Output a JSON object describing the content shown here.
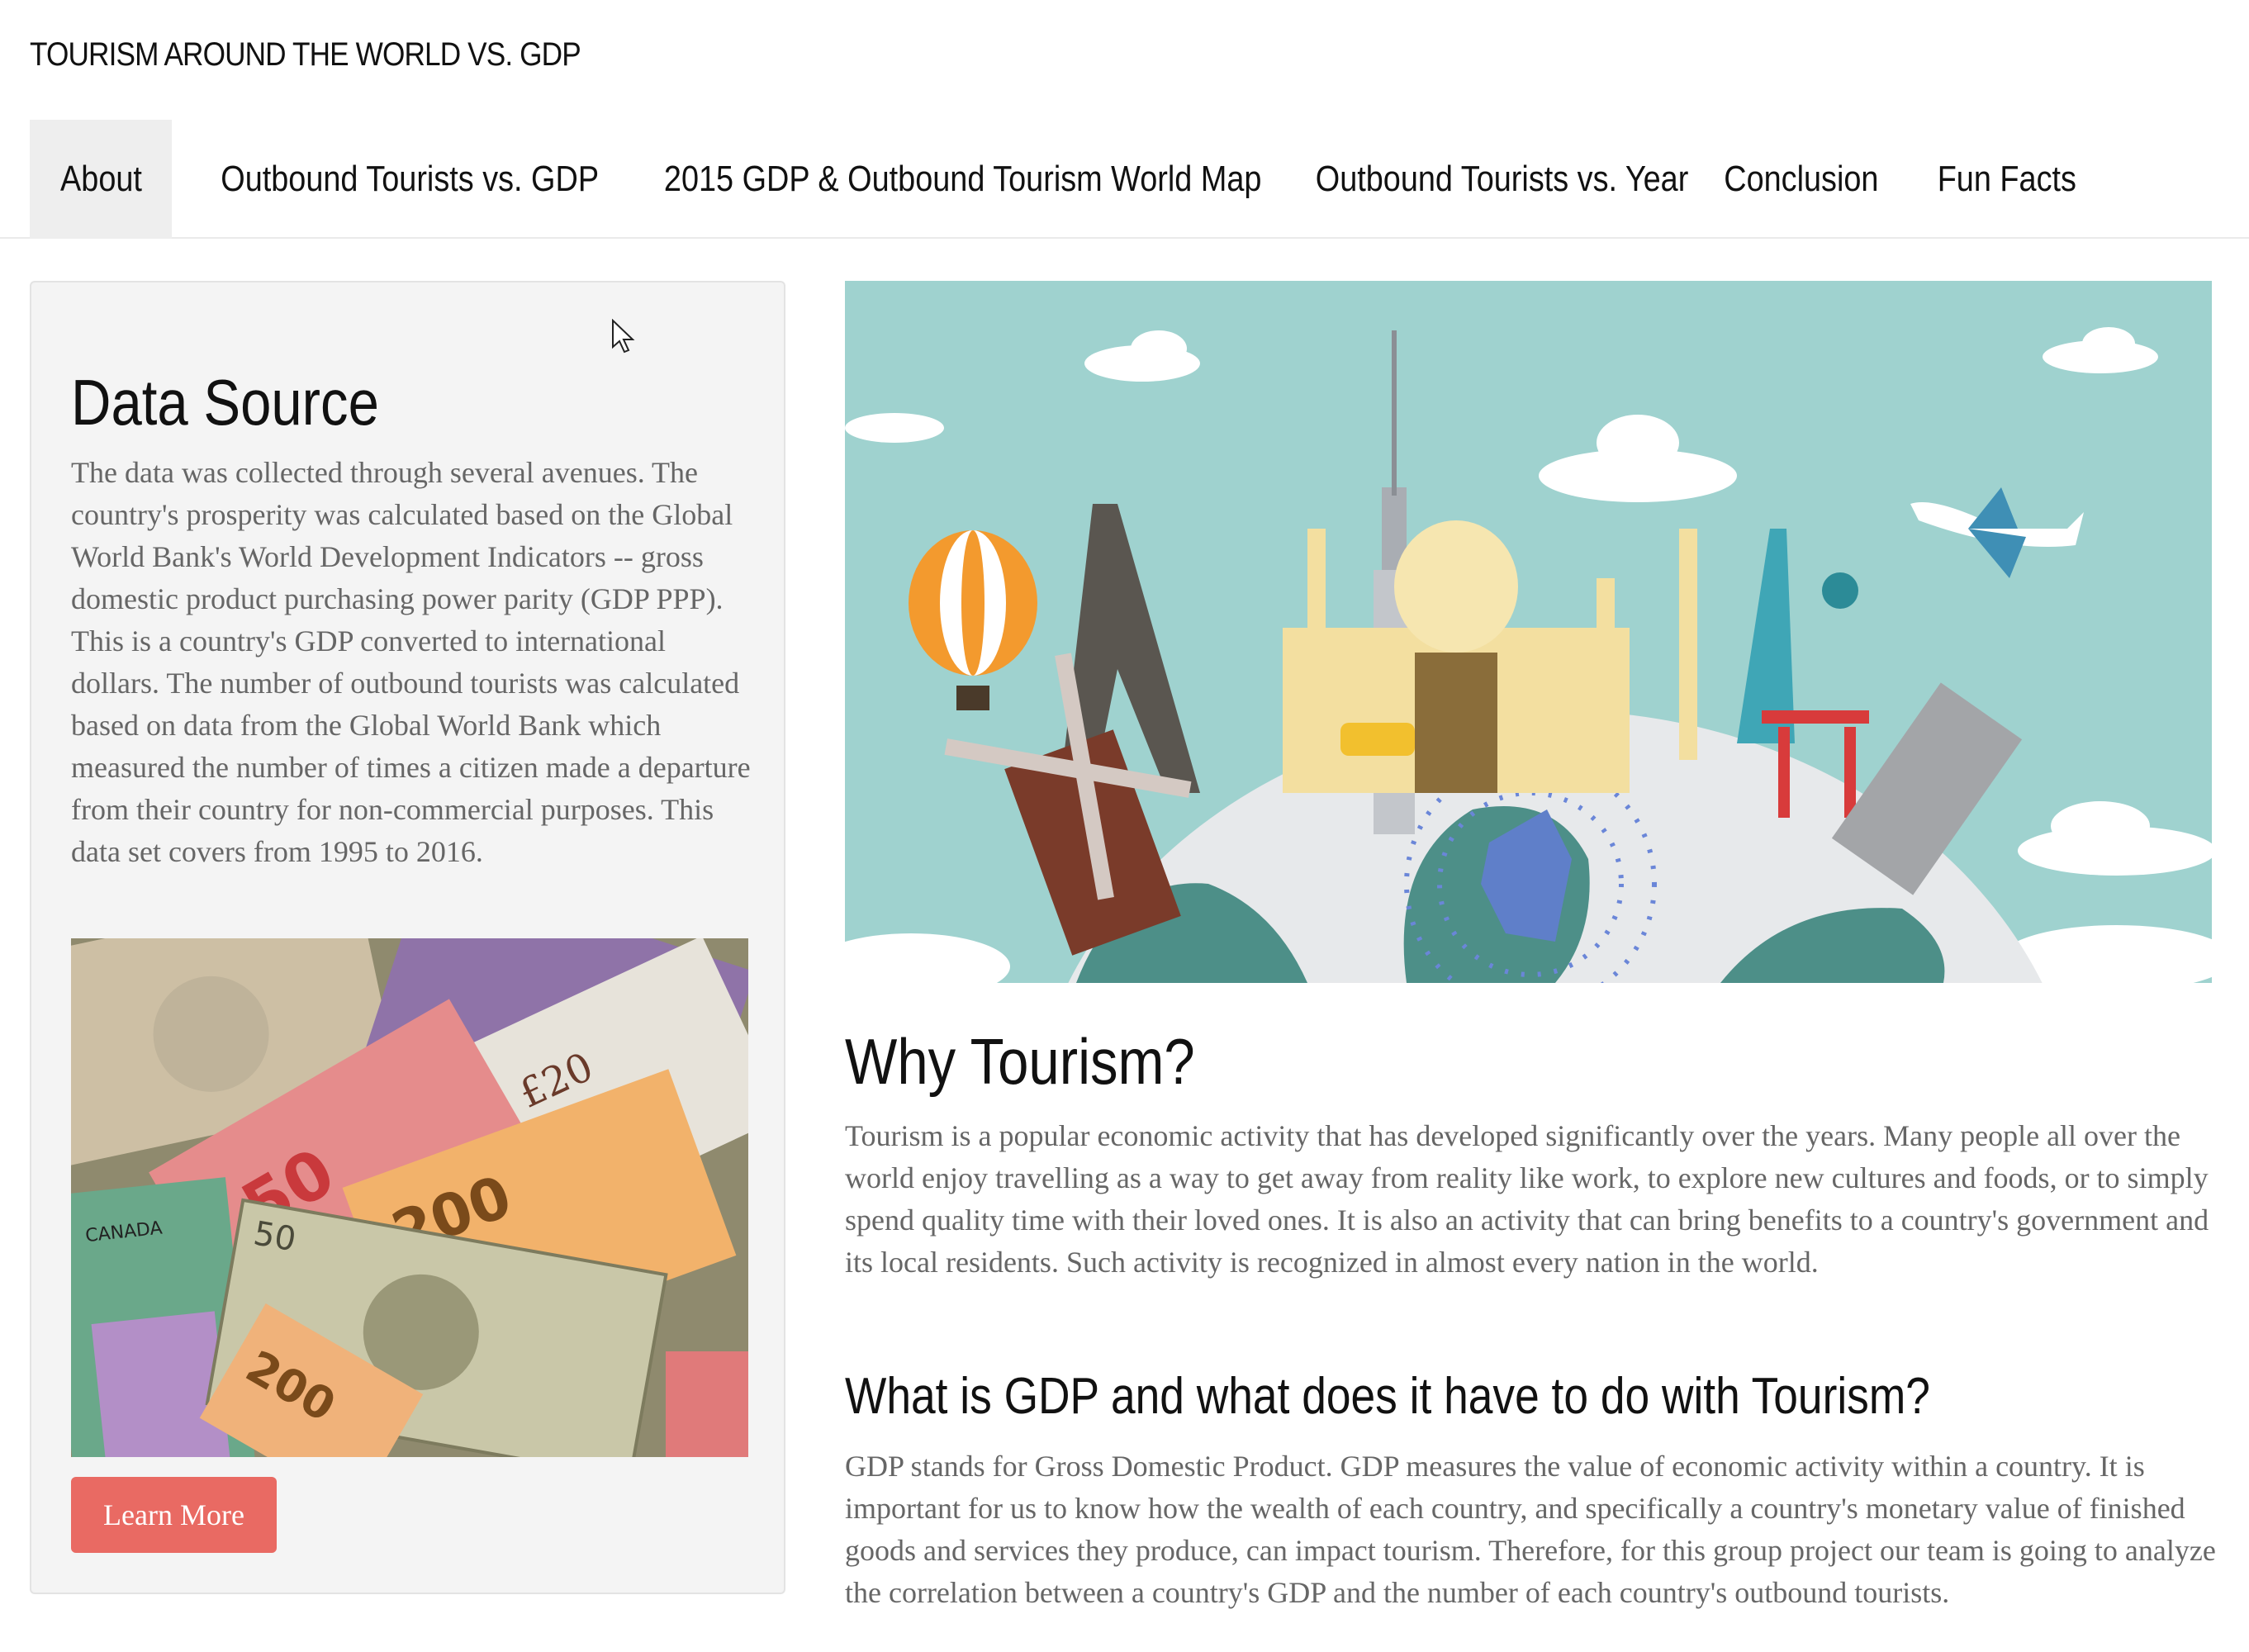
{
  "site": {
    "title": "TOURISM AROUND THE WORLD VS. GDP"
  },
  "nav": {
    "items": [
      {
        "label": "About",
        "active": true
      },
      {
        "label": "Outbound Tourists vs. GDP"
      },
      {
        "label": "2015 GDP & Outbound Tourism World Map"
      },
      {
        "label": "Outbound Tourists vs. Year"
      },
      {
        "label": "Conclusion"
      },
      {
        "label": "Fun Facts"
      }
    ]
  },
  "data_source": {
    "heading": "Data Source",
    "body": "The data was collected through several avenues. The country's prosperity was calculated based on the Global World Bank's World Development Indicators -- gross domestic product purchasing power parity (GDP PPP). This is a country's GDP converted to international dollars. The number of outbound tourists was calculated based on data from the Global World Bank which measured the number of times a citizen made a departure from their country for non-commercial purposes. This data set covers from 1995 to 2016.",
    "image_icon": "banknotes-image",
    "button_label": "Learn More"
  },
  "why_tourism": {
    "heading": "Why Tourism?",
    "body": "Tourism is a popular economic activity that has developed significantly over the years. Many people all over the world enjoy travelling as a way to get away from reality like work, to explore new cultures and foods, or to simply spend quality time with their loved ones. It is also an activity that can bring benefits to a country's government and its local residents. Such activity is recognized in almost every nation in the world."
  },
  "gdp": {
    "heading": "What is GDP and what does it have to do with Tourism?",
    "body": "GDP stands for Gross Domestic Product. GDP measures the value of economic activity within a country. It is important for us to know how the wealth of each country, and specifically a country's monetary value of finished goods and services they produce, can impact tourism. Therefore, for this group project our team is going to analyze the correlation between a country's GDP and the number of each country's outbound tourists."
  },
  "hero": {
    "image_icon": "world-landmarks-illustration"
  },
  "colors": {
    "button": "#e96a63",
    "sky": "#9fd2cf",
    "active_tab": "#eeeeee",
    "card_bg": "#f4f4f4",
    "body_text": "#666666"
  }
}
